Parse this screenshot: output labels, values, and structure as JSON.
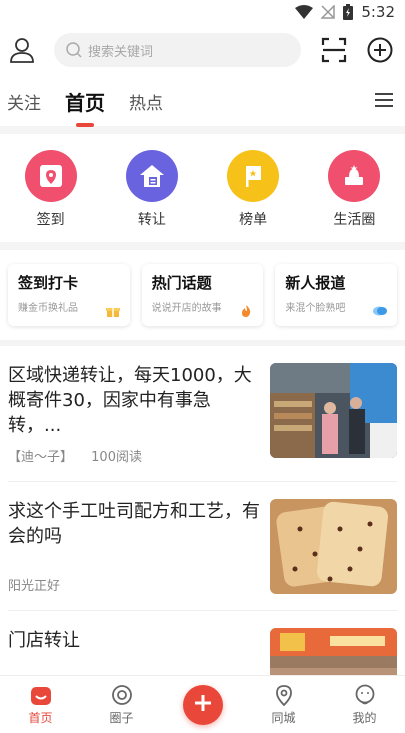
{
  "status": {
    "time": "5:32"
  },
  "search": {
    "placeholder": "搜索关键词"
  },
  "tabs": [
    {
      "label": "关注",
      "active": false
    },
    {
      "label": "首页",
      "active": true
    },
    {
      "label": "热点",
      "active": false
    }
  ],
  "quick": [
    {
      "label": "签到",
      "icon": "map-checkin-icon",
      "color": "#f0506e"
    },
    {
      "label": "转让",
      "icon": "home-transfer-icon",
      "color": "#6a63e0"
    },
    {
      "label": "榜单",
      "icon": "flag-icon",
      "color": "#f6c21a"
    },
    {
      "label": "生活圈",
      "icon": "hat-icon",
      "color": "#f0506e"
    }
  ],
  "cards": [
    {
      "title": "签到打卡",
      "sub": "赚金币换礼品",
      "badge": "gift-icon",
      "color": "#f6b73c"
    },
    {
      "title": "热门话题",
      "sub": "说说开店的故事",
      "badge": "fire-icon",
      "color": "#f5892a"
    },
    {
      "title": "新人报道",
      "sub": "来混个脸熟吧",
      "badge": "chat-icon",
      "color": "#3a9ae8"
    }
  ],
  "posts": [
    {
      "title": "区域快递转让，每天1000，大概寄件30，因家中有事急转，...",
      "author": "【迪～子】",
      "reads": "100阅读"
    },
    {
      "title": "求这个手工吐司配方和工艺，有会的吗",
      "author": "阳光正好",
      "reads": ""
    },
    {
      "title": "门店转让",
      "author": "",
      "reads": ""
    }
  ],
  "nav": [
    {
      "label": "首页",
      "active": true
    },
    {
      "label": "圈子",
      "active": false
    },
    {
      "label": "",
      "active": false
    },
    {
      "label": "同城",
      "active": false
    },
    {
      "label": "我的",
      "active": false
    }
  ]
}
